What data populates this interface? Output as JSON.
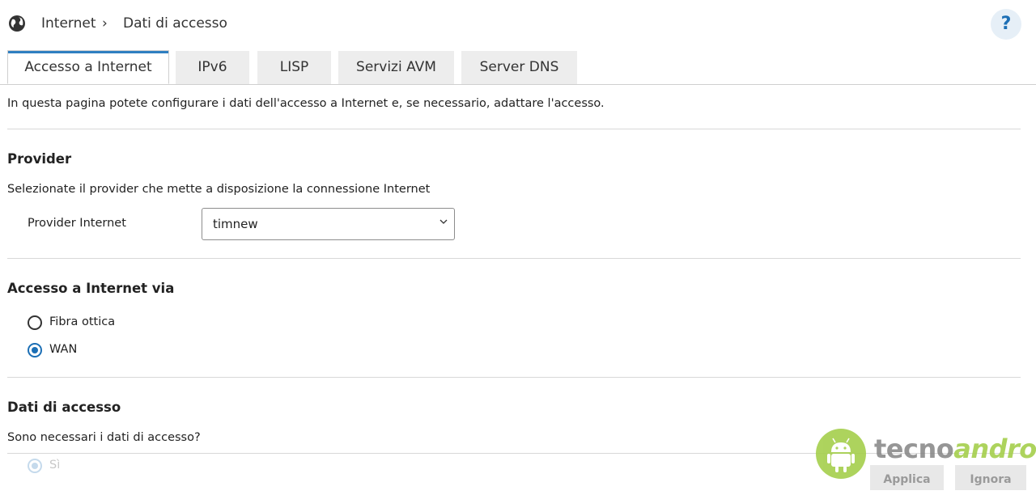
{
  "header": {
    "breadcrumb": [
      "Internet",
      "Dati di accesso"
    ],
    "separator": "›",
    "help_label": "?"
  },
  "tabs": [
    {
      "label": "Accesso a Internet",
      "active": true
    },
    {
      "label": "IPv6",
      "active": false
    },
    {
      "label": "LISP",
      "active": false
    },
    {
      "label": "Servizi AVM",
      "active": false
    },
    {
      "label": "Server DNS",
      "active": false
    }
  ],
  "intro": "In questa pagina potete configurare i dati dell'accesso a Internet e, se necessario, adattare l'accesso.",
  "provider": {
    "title": "Provider",
    "description": "Selezionate il provider che mette a disposizione la connessione Internet",
    "field_label": "Provider Internet",
    "selected": "timnew"
  },
  "access": {
    "title": "Accesso a Internet via",
    "options": [
      {
        "label": "Fibra ottica",
        "checked": false
      },
      {
        "label": "WAN",
        "checked": true
      }
    ]
  },
  "credentials": {
    "title": "Dati di accesso",
    "question": "Sono necessari i dati di accesso?",
    "option_yes": "Sì"
  },
  "buttons": {
    "apply": "Applica",
    "ignore": "Ignora"
  },
  "watermark": {
    "part1": "tecno",
    "part2": "android"
  },
  "colors": {
    "accent": "#1c6fb5",
    "watermark_green": "#a5cf4c"
  }
}
